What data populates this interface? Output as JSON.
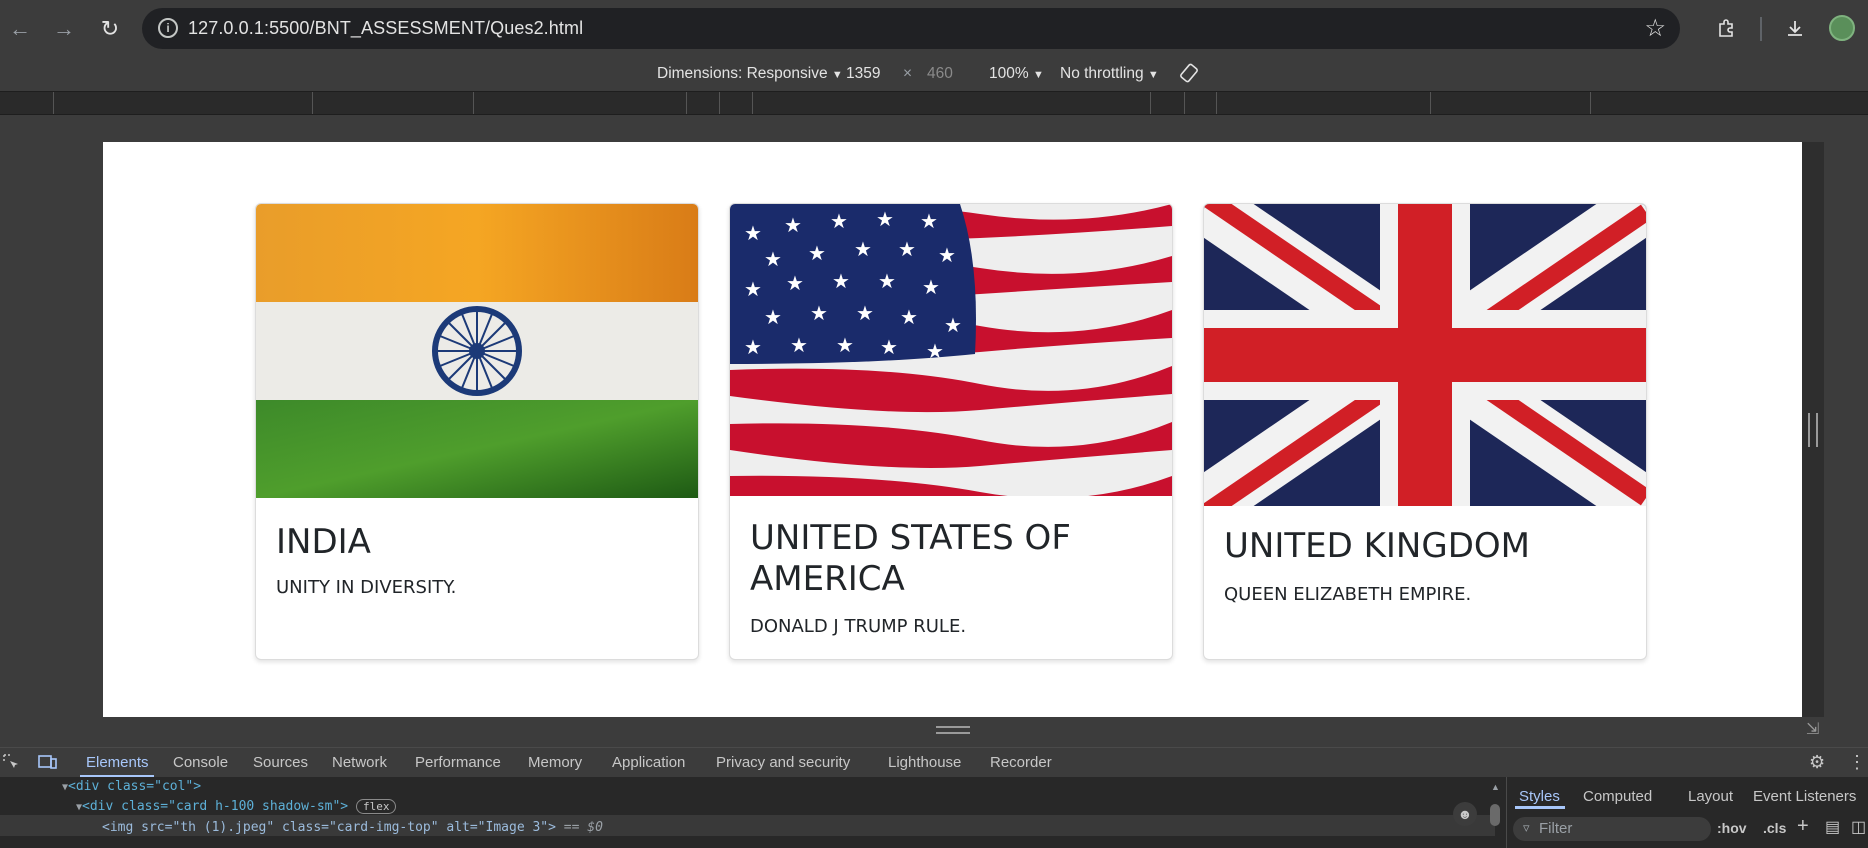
{
  "browser": {
    "url": "127.0.0.1:5500/BNT_ASSESSMENT/Ques2.html"
  },
  "device_toolbar": {
    "dimensions_label": "Dimensions: Responsive",
    "width": "1359",
    "times": "×",
    "height": "460",
    "zoom": "100%",
    "throttling": "No throttling"
  },
  "cards": [
    {
      "title": "INDIA",
      "text": "UNITY IN DIVERSITY.",
      "image": "india-flag"
    },
    {
      "title": "UNITED STATES OF AMERICA",
      "text": "DONALD J TRUMP RULE.",
      "image": "usa-flag"
    },
    {
      "title": "UNITED KINGDOM",
      "text": "QUEEN ELIZABETH EMPIRE.",
      "image": "uk-flag"
    }
  ],
  "devtools": {
    "tabs": [
      "Elements",
      "Console",
      "Sources",
      "Network",
      "Performance",
      "Memory",
      "Application",
      "Privacy and security",
      "Lighthouse",
      "Recorder"
    ],
    "active_tab": "Elements",
    "dom_lines": {
      "line1_tag": "<div class=\"col\">",
      "line2_tag": "<div class=\"card h-100 shadow-sm\">",
      "line2_badge": "flex",
      "line3_img": "<img src=\"th (1).jpeg\" class=\"card-img-top\" alt=\"Image 3\">",
      "line3_suffix": "== $0"
    },
    "styles_tabs": [
      "Styles",
      "Computed",
      "Layout",
      "Event Listeners"
    ],
    "filter_placeholder": "Filter",
    "hov": ":hov",
    "cls": ".cls"
  }
}
